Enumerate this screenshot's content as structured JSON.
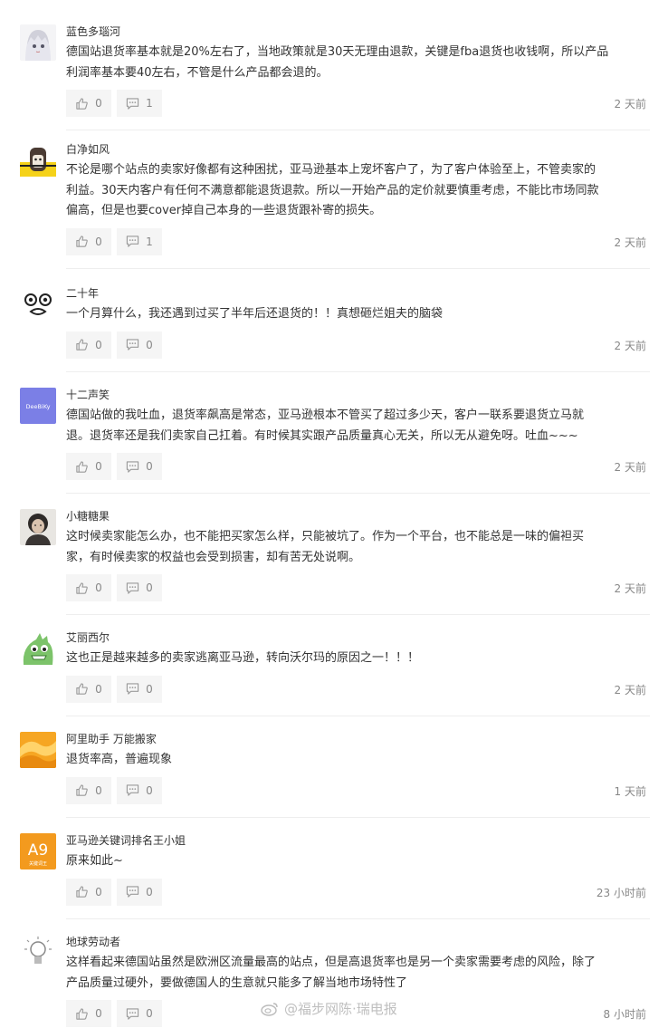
{
  "comments": [
    {
      "user": "蓝色多瑙河",
      "lines": [
        "德国站退货率基本就是20%左右了，当地政策就是30天无理由退款，关键是fba退货也收钱啊，所以产品",
        "利润率基本要40左右，不管是什么产品都会退的。"
      ],
      "likes": "0",
      "replies": "1",
      "time": "2 天前",
      "avatar": "anime-girl-avatar"
    },
    {
      "user": "白净如风",
      "lines": [
        "不论是哪个站点的卖家好像都有这种困扰，亚马逊基本上宠坏客户了，为了客户体验至上，不管卖家的",
        "利益。30天内客户有任何不满意都能退货退款。所以一开始产品的定价就要慎重考虑，不能比市场同款",
        "偏高，但是也要cover掉自己本身的一些退货跟补寄的损失。"
      ],
      "likes": "0",
      "replies": "1",
      "time": "2 天前",
      "avatar": "yellow-cartoon-avatar"
    },
    {
      "user": "二十年",
      "lines": [
        "一个月算什么，我还遇到过买了半年后还退货的！！真想砸烂姐夫的脑袋"
      ],
      "likes": "0",
      "replies": "0",
      "time": "2 天前",
      "avatar": "funny-face-avatar"
    },
    {
      "user": "十二声笑",
      "lines": [
        "德国站做的我吐血，退货率飙高是常态，亚马逊根本不管买了超过多少天，客户一联系要退货立马就",
        "退。退货率还是我们卖家自己扛着。有时候其实跟产品质量真心无关，所以无从避免呀。吐血~~~"
      ],
      "likes": "0",
      "replies": "0",
      "time": "2 天前",
      "avatar": "purple-logo-avatar",
      "avatar_text": "DeeBiKy"
    },
    {
      "user": "小糖糖果",
      "lines": [
        "这时候卖家能怎么办，也不能把买家怎么样，只能被坑了。作为一个平台，也不能总是一味的偏袒买",
        "家，有时候卖家的权益也会受到损害，却有苦无处说啊。"
      ],
      "likes": "0",
      "replies": "0",
      "time": "2 天前",
      "avatar": "portrait-avatar"
    },
    {
      "user": "艾丽西尔",
      "lines": [
        "这也正是越来越多的卖家逃离亚马逊，转向沃尔玛的原因之一！！！"
      ],
      "likes": "0",
      "replies": "0",
      "time": "2 天前",
      "avatar": "green-dino-avatar"
    },
    {
      "user": "阿里助手 万能搬家",
      "lines": [
        "退货率高，普遍现象"
      ],
      "likes": "0",
      "replies": "0",
      "time": "1 天前",
      "avatar": "orange-swirl-avatar"
    },
    {
      "user": "亚马逊关键词排名王小姐",
      "lines": [
        "原来如此~"
      ],
      "likes": "0",
      "replies": "0",
      "time": "23 小时前",
      "avatar": "a9-logo-avatar",
      "avatar_text": "A9",
      "avatar_subtext": "关键词王"
    },
    {
      "user": "地球劳动者",
      "lines": [
        "这样看起来德国站虽然是欧洲区流量最高的站点，但是高退货率也是另一个卖家需要考虑的风险，除了",
        "产品质量过硬外，要做德国人的生意就只能多了解当地市场特性了"
      ],
      "likes": "0",
      "replies": "0",
      "time": "8 小时前",
      "avatar": "lightbulb-avatar"
    }
  ],
  "watermark": "@福步网陈·瑞电报",
  "colors": {
    "accent_purple": "#7b7fe6",
    "btn_bg": "#f5f5f5",
    "meta_gray": "#888888"
  }
}
